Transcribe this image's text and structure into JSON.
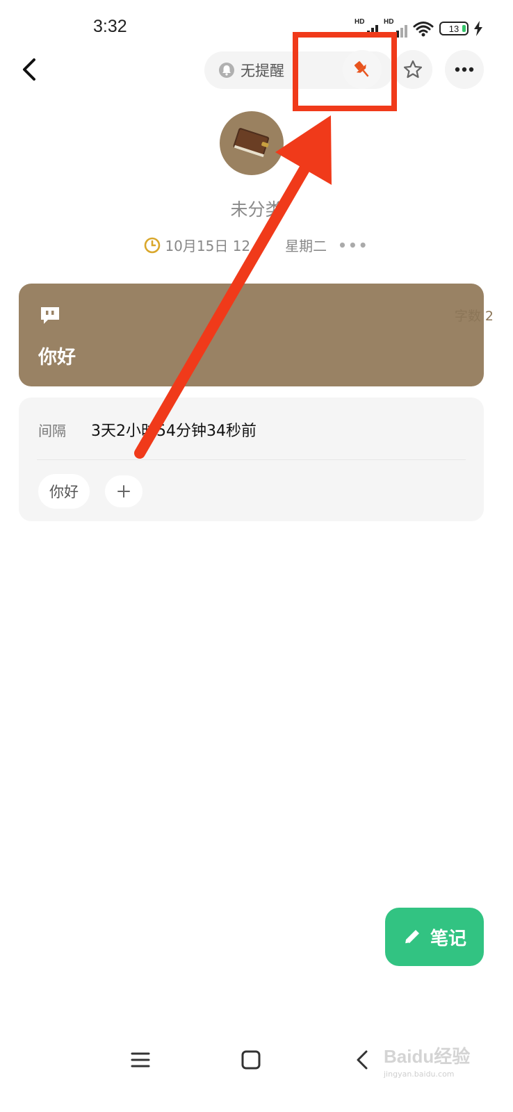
{
  "status_bar": {
    "time": "3:32",
    "network_label_1": "HD",
    "network_label_2": "HD",
    "battery": "13"
  },
  "toolbar": {
    "reminder_label": "无提醒",
    "icons": [
      "back-arrow-icon",
      "bell-icon",
      "pin-icon",
      "star-icon",
      "more-icon"
    ]
  },
  "note": {
    "category_title": "未分类",
    "date_text": "10月15日 12",
    "weekday": "星期二",
    "date_more": "•••",
    "content": "你好",
    "word_count_label": "字数 2"
  },
  "info": {
    "interval_label": "间隔",
    "interval_value": "3天2小时54分钟34秒前",
    "tag": "你好"
  },
  "fab": {
    "label": "笔记"
  },
  "watermark": {
    "brand": "Baidu经验",
    "url": "jingyan.baidu.com"
  },
  "colors": {
    "accent_brown": "#998264",
    "fab_green": "#32c382",
    "annotation_red": "#f03a1a",
    "pin_orange": "#e8541e"
  }
}
